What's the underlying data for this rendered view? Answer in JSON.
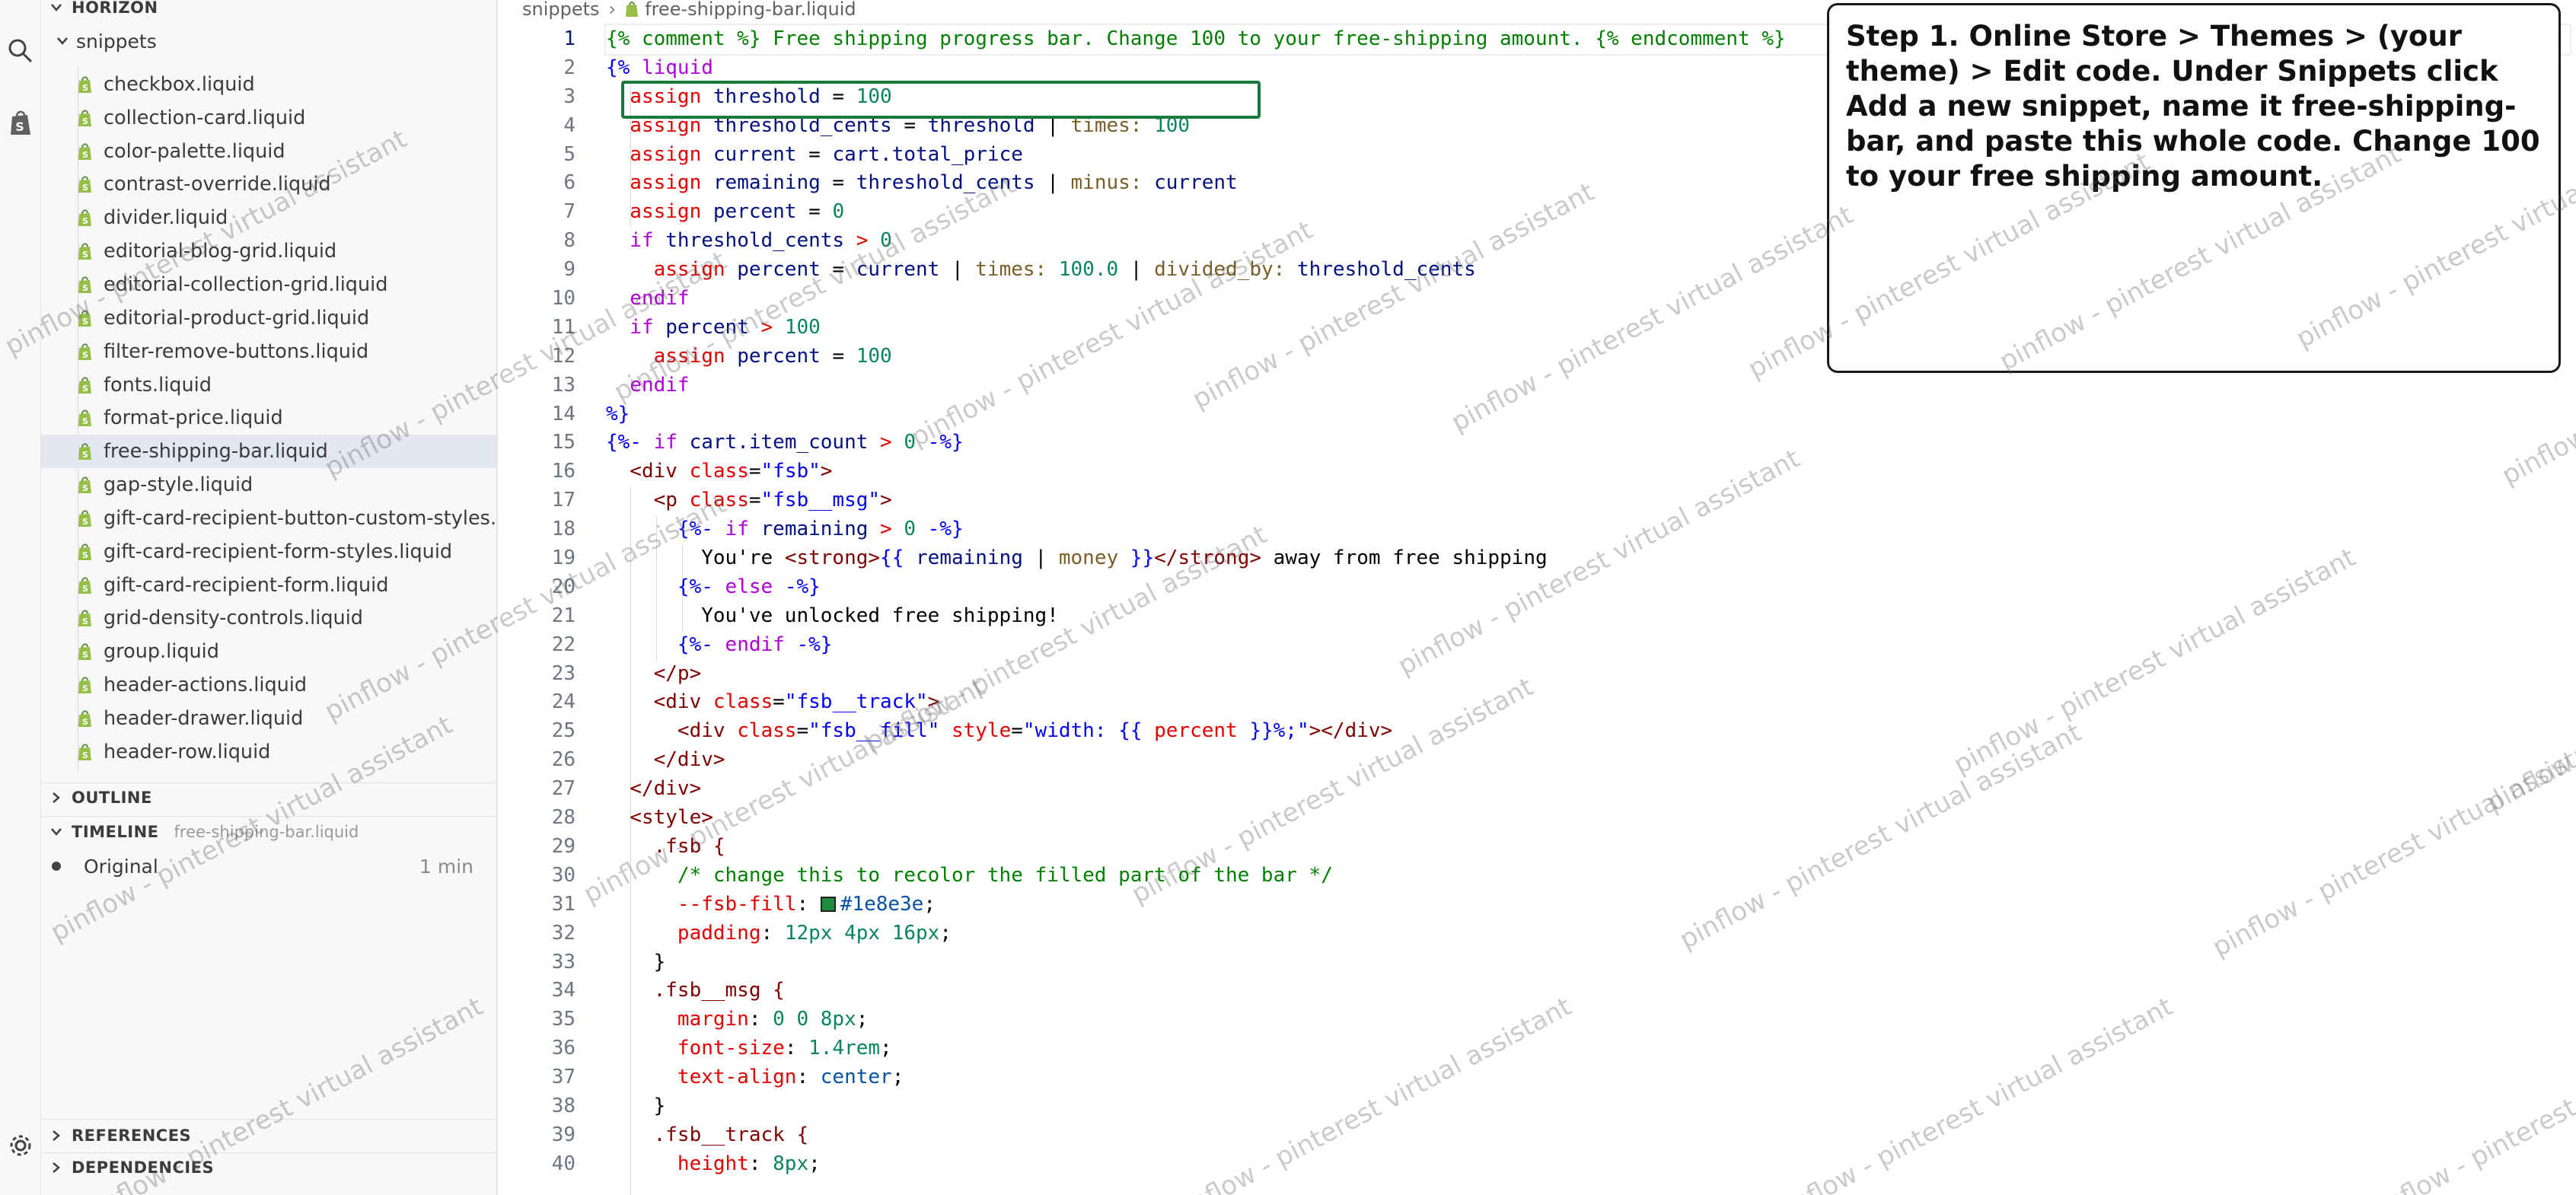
{
  "sidebar": {
    "project_title": "HORIZON",
    "folder": "snippets",
    "files": [
      {
        "name": "checkbox.liquid"
      },
      {
        "name": "collection-card.liquid"
      },
      {
        "name": "color-palette.liquid"
      },
      {
        "name": "contrast-override.liquid"
      },
      {
        "name": "divider.liquid"
      },
      {
        "name": "editorial-blog-grid.liquid"
      },
      {
        "name": "editorial-collection-grid.liquid"
      },
      {
        "name": "editorial-product-grid.liquid"
      },
      {
        "name": "filter-remove-buttons.liquid"
      },
      {
        "name": "fonts.liquid"
      },
      {
        "name": "format-price.liquid"
      },
      {
        "name": "free-shipping-bar.liquid",
        "selected": true
      },
      {
        "name": "gap-style.liquid"
      },
      {
        "name": "gift-card-recipient-button-custom-styles.li..."
      },
      {
        "name": "gift-card-recipient-form-styles.liquid"
      },
      {
        "name": "gift-card-recipient-form.liquid"
      },
      {
        "name": "grid-density-controls.liquid"
      },
      {
        "name": "group.liquid"
      },
      {
        "name": "header-actions.liquid"
      },
      {
        "name": "header-drawer.liquid"
      },
      {
        "name": "header-row.liquid"
      }
    ],
    "outline_label": "OUTLINE",
    "timeline_label": "TIMELINE",
    "timeline_file": "free-shipping-bar.liquid",
    "timeline_entry": "Original",
    "timeline_time": "1 min",
    "references_label": "REFERENCES",
    "dependencies_label": "DEPENDENCIES"
  },
  "editor": {
    "breadcrumb": {
      "folder": "snippets",
      "file": "free-shipping-bar.liquid"
    },
    "active_line": 1,
    "line_numbers": [
      "1",
      "2",
      "3",
      "4",
      "5",
      "6",
      "7",
      "8",
      "9",
      "10",
      "11",
      "12",
      "13",
      "14",
      "15",
      "16",
      "17",
      "18",
      "19",
      "20",
      "21",
      "22",
      "23",
      "24",
      "25",
      "26",
      "27",
      "28",
      "29",
      "30",
      "31",
      "32",
      "33",
      "34",
      "35",
      "36",
      "37",
      "38",
      "39",
      "40"
    ],
    "lines": [
      [
        {
          "t": "{% comment %} Free shipping progress bar. Change 100 to your free-shipping amount. {% endcomment %}",
          "c": "cmt"
        }
      ],
      [
        {
          "t": "{% ",
          "c": "tag"
        },
        {
          "t": "liquid",
          "c": "kw"
        }
      ],
      [
        {
          "t": "  assign ",
          "c": "red"
        },
        {
          "t": "threshold",
          "c": "var"
        },
        {
          "t": " = ",
          "c": "op"
        },
        {
          "t": "100",
          "c": "num"
        }
      ],
      [
        {
          "t": "  assign ",
          "c": "red"
        },
        {
          "t": "threshold_cents",
          "c": "var"
        },
        {
          "t": " = ",
          "c": "op"
        },
        {
          "t": "threshold",
          "c": "var"
        },
        {
          "t": " | ",
          "c": "op"
        },
        {
          "t": "times:",
          "c": "flt"
        },
        {
          "t": " 100",
          "c": "num"
        }
      ],
      [
        {
          "t": "  assign ",
          "c": "red"
        },
        {
          "t": "current",
          "c": "var"
        },
        {
          "t": " = ",
          "c": "op"
        },
        {
          "t": "cart.total_price",
          "c": "var"
        }
      ],
      [
        {
          "t": "  assign ",
          "c": "red"
        },
        {
          "t": "remaining",
          "c": "var"
        },
        {
          "t": " = ",
          "c": "op"
        },
        {
          "t": "threshold_cents",
          "c": "var"
        },
        {
          "t": " | ",
          "c": "op"
        },
        {
          "t": "minus:",
          "c": "flt"
        },
        {
          "t": " current",
          "c": "var"
        }
      ],
      [
        {
          "t": "  assign ",
          "c": "red"
        },
        {
          "t": "percent",
          "c": "var"
        },
        {
          "t": " = ",
          "c": "op"
        },
        {
          "t": "0",
          "c": "num"
        }
      ],
      [
        {
          "t": "  if ",
          "c": "kw"
        },
        {
          "t": "threshold_cents",
          "c": "var"
        },
        {
          "t": " > ",
          "c": "red"
        },
        {
          "t": "0",
          "c": "num"
        }
      ],
      [
        {
          "t": "    assign ",
          "c": "red"
        },
        {
          "t": "percent",
          "c": "var"
        },
        {
          "t": " = ",
          "c": "op"
        },
        {
          "t": "current",
          "c": "var"
        },
        {
          "t": " | ",
          "c": "op"
        },
        {
          "t": "times:",
          "c": "flt"
        },
        {
          "t": " 100.0",
          "c": "num"
        },
        {
          "t": " | ",
          "c": "op"
        },
        {
          "t": "divided_by:",
          "c": "flt"
        },
        {
          "t": " threshold_cents",
          "c": "var"
        }
      ],
      [
        {
          "t": "  endif",
          "c": "kw"
        }
      ],
      [
        {
          "t": "  if ",
          "c": "kw"
        },
        {
          "t": "percent",
          "c": "var"
        },
        {
          "t": " > ",
          "c": "red"
        },
        {
          "t": "100",
          "c": "num"
        }
      ],
      [
        {
          "t": "    assign ",
          "c": "red"
        },
        {
          "t": "percent",
          "c": "var"
        },
        {
          "t": " = ",
          "c": "op"
        },
        {
          "t": "100",
          "c": "num"
        }
      ],
      [
        {
          "t": "  endif",
          "c": "kw"
        }
      ],
      [
        {
          "t": "%}",
          "c": "tag"
        }
      ],
      [
        {
          "t": "{%- ",
          "c": "tag"
        },
        {
          "t": "if ",
          "c": "kw"
        },
        {
          "t": "cart.item_count",
          "c": "var"
        },
        {
          "t": " > ",
          "c": "red"
        },
        {
          "t": "0",
          "c": "num"
        },
        {
          "t": " -%}",
          "c": "tag"
        }
      ],
      [
        {
          "t": "  <div ",
          "c": "htag"
        },
        {
          "t": "class",
          "c": "attr"
        },
        {
          "t": "=",
          "c": "op"
        },
        {
          "t": "\"fsb\"",
          "c": "str"
        },
        {
          "t": ">",
          "c": "htag"
        }
      ],
      [
        {
          "t": "    <p ",
          "c": "htag"
        },
        {
          "t": "class",
          "c": "attr"
        },
        {
          "t": "=",
          "c": "op"
        },
        {
          "t": "\"fsb__msg\"",
          "c": "str"
        },
        {
          "t": ">",
          "c": "htag"
        }
      ],
      [
        {
          "t": "      {%- ",
          "c": "tag"
        },
        {
          "t": "if ",
          "c": "kw"
        },
        {
          "t": "remaining",
          "c": "var"
        },
        {
          "t": " > ",
          "c": "red"
        },
        {
          "t": "0",
          "c": "num"
        },
        {
          "t": " -%}",
          "c": "tag"
        }
      ],
      [
        {
          "t": "        You're ",
          "c": "txt"
        },
        {
          "t": "<strong>",
          "c": "htag"
        },
        {
          "t": "{{ ",
          "c": "tag"
        },
        {
          "t": "remaining",
          "c": "var"
        },
        {
          "t": " | ",
          "c": "op"
        },
        {
          "t": "money",
          "c": "flt"
        },
        {
          "t": " }}",
          "c": "tag"
        },
        {
          "t": "</strong>",
          "c": "htag"
        },
        {
          "t": " away from free shipping",
          "c": "txt"
        }
      ],
      [
        {
          "t": "      {%- ",
          "c": "tag"
        },
        {
          "t": "else",
          "c": "kw"
        },
        {
          "t": " -%}",
          "c": "tag"
        }
      ],
      [
        {
          "t": "        You've unlocked free shipping!",
          "c": "txt"
        }
      ],
      [
        {
          "t": "      {%- ",
          "c": "tag"
        },
        {
          "t": "endif",
          "c": "kw"
        },
        {
          "t": " -%}",
          "c": "tag"
        }
      ],
      [
        {
          "t": "    </p>",
          "c": "htag"
        }
      ],
      [
        {
          "t": "    <div ",
          "c": "htag"
        },
        {
          "t": "class",
          "c": "attr"
        },
        {
          "t": "=",
          "c": "op"
        },
        {
          "t": "\"fsb__track\"",
          "c": "str"
        },
        {
          "t": ">",
          "c": "htag"
        }
      ],
      [
        {
          "t": "      <div ",
          "c": "htag"
        },
        {
          "t": "class",
          "c": "attr"
        },
        {
          "t": "=",
          "c": "op"
        },
        {
          "t": "\"fsb__fill\" ",
          "c": "str"
        },
        {
          "t": "style",
          "c": "attr"
        },
        {
          "t": "=",
          "c": "op"
        },
        {
          "t": "\"width: ",
          "c": "str"
        },
        {
          "t": "{{ ",
          "c": "tag"
        },
        {
          "t": "percent",
          "c": "attr"
        },
        {
          "t": " }}",
          "c": "tag"
        },
        {
          "t": "%;\"",
          "c": "str"
        },
        {
          "t": "></div>",
          "c": "htag"
        }
      ],
      [
        {
          "t": "    </div>",
          "c": "htag"
        }
      ],
      [
        {
          "t": "  </div>",
          "c": "htag"
        }
      ],
      [
        {
          "t": "  <style>",
          "c": "htag"
        }
      ],
      [
        {
          "t": "    .fsb {",
          "c": "sel"
        }
      ],
      [
        {
          "t": "      /* change this to recolor the filled part of the bar */",
          "c": "cmt"
        }
      ],
      [
        {
          "t": "      --fsb-fill",
          "c": "prop"
        },
        {
          "t": ": ",
          "c": "op"
        },
        {
          "t": "#1e8e3e",
          "c": "val",
          "swatch": true
        },
        {
          "t": ";",
          "c": "op"
        }
      ],
      [
        {
          "t": "      padding",
          "c": "prop"
        },
        {
          "t": ": ",
          "c": "op"
        },
        {
          "t": "12px 4px 16px",
          "c": "num"
        },
        {
          "t": ";",
          "c": "op"
        }
      ],
      [
        {
          "t": "    }",
          "c": "op"
        }
      ],
      [
        {
          "t": "    .fsb__msg {",
          "c": "sel"
        }
      ],
      [
        {
          "t": "      margin",
          "c": "prop"
        },
        {
          "t": ": ",
          "c": "op"
        },
        {
          "t": "0 0 8px",
          "c": "num"
        },
        {
          "t": ";",
          "c": "op"
        }
      ],
      [
        {
          "t": "      font-size",
          "c": "prop"
        },
        {
          "t": ": ",
          "c": "op"
        },
        {
          "t": "1.4rem",
          "c": "num"
        },
        {
          "t": ";",
          "c": "op"
        }
      ],
      [
        {
          "t": "      text-align",
          "c": "prop"
        },
        {
          "t": ": ",
          "c": "op"
        },
        {
          "t": "center",
          "c": "val"
        },
        {
          "t": ";",
          "c": "op"
        }
      ],
      [
        {
          "t": "    }",
          "c": "op"
        }
      ],
      [
        {
          "t": "    .fsb__track {",
          "c": "sel"
        }
      ],
      [
        {
          "t": "      height",
          "c": "prop"
        },
        {
          "t": ": ",
          "c": "op"
        },
        {
          "t": "8px",
          "c": "num"
        },
        {
          "t": ";",
          "c": "op"
        }
      ]
    ]
  },
  "callout": {
    "text": "Step 1. Online Store > Themes > (your theme) > Edit code. Under Snippets click Add a new snippet, name it free-shipping-bar, and paste this whole code. Change 100 to your free shipping amount."
  },
  "watermark": {
    "text": "pinflow - pinterest virtual assistant"
  },
  "colors": {
    "highlight_box": "#1a7a3c",
    "swatch": "#1e8e3e",
    "selected_row": "#e4e6f1"
  }
}
